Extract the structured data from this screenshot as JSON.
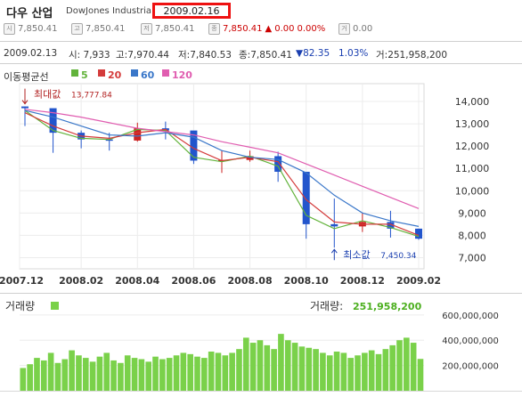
{
  "header": {
    "title": "다우 산업",
    "subtitle": "DowJones Industrial",
    "date": "2009.02.16"
  },
  "quote": {
    "open_icon": "시",
    "open": "7,850.41",
    "high_icon": "고",
    "high": "7,850.41",
    "low_icon": "저",
    "low": "7,850.41",
    "close_icon": "종",
    "close": "7,850.41",
    "change_arrow": "▲",
    "change": "0.00",
    "change_pct": "0.00%",
    "volume_icon": "거",
    "volume": "0.00"
  },
  "info": {
    "date": "2009.02.13",
    "open": "시: 7,933",
    "high": "고:7,970.44",
    "low": "저:7,840.53",
    "close": "종:7,850.41",
    "change": "▼82.35",
    "change_pct": "1.03%",
    "volume": "거:251,958,200"
  },
  "moving_avg": {
    "label": "이동평균선",
    "items": [
      {
        "period": "5",
        "color": "#62b33b"
      },
      {
        "period": "20",
        "color": "#d43b3b"
      },
      {
        "period": "60",
        "color": "#3a77c9"
      },
      {
        "period": "120",
        "color": "#e05db0"
      }
    ]
  },
  "volume_panel": {
    "title": "거래량",
    "value_label": "거래량:",
    "value": "251,958,200"
  },
  "colors": {
    "up": "#cc2222",
    "down": "#2255cc",
    "volume": "#7ad14a",
    "annotation_high": "#b22222",
    "annotation_low": "#1a3fb0"
  },
  "chart_data": [
    {
      "type": "candlestick",
      "title": "",
      "x": [
        "2007.12",
        "2008.01",
        "2008.02",
        "2008.03",
        "2008.04",
        "2008.05",
        "2008.06",
        "2008.07",
        "2008.08",
        "2008.09",
        "2008.10",
        "2008.11",
        "2008.12",
        "2009.01",
        "2009.02"
      ],
      "x_tick_labels": [
        "2007.12",
        "2008.02",
        "2008.04",
        "2008.06",
        "2008.08",
        "2008.10",
        "2008.12",
        "2009.02"
      ],
      "close": [
        13700,
        12600,
        12300,
        12250,
        12800,
        12700,
        11350,
        11380,
        11550,
        10850,
        8500,
        8400,
        8600,
        8300,
        7850
      ],
      "high": [
        13778,
        13100,
        12700,
        12600,
        13050,
        13100,
        12500,
        11800,
        11800,
        11750,
        10850,
        9650,
        9000,
        9100,
        8300
      ],
      "low": [
        12900,
        11700,
        11900,
        11800,
        12200,
        12300,
        11200,
        10800,
        11300,
        10400,
        7850,
        7450,
        8150,
        7900,
        7800
      ],
      "ylim": [
        6500,
        14800
      ],
      "y_ticks": [
        7000,
        8000,
        9000,
        10000,
        11000,
        12000,
        13000,
        14000
      ],
      "y_tick_labels": [
        "7,000",
        "8,000",
        "9,000",
        "10,000",
        "11,000",
        "12,000",
        "13,000",
        "14,000"
      ],
      "moving_averages": [
        {
          "name": "5",
          "values": [
            13600,
            12700,
            12350,
            12300,
            12750,
            12700,
            11500,
            11300,
            11550,
            11100,
            8900,
            8300,
            8650,
            8350,
            7950
          ]
        },
        {
          "name": "20",
          "values": [
            13500,
            12900,
            12450,
            12350,
            12600,
            12750,
            11900,
            11350,
            11500,
            11300,
            9600,
            8600,
            8500,
            8500,
            8000
          ]
        },
        {
          "name": "60",
          "values": [
            13600,
            13300,
            12900,
            12500,
            12450,
            12600,
            12400,
            11800,
            11500,
            11400,
            10800,
            9800,
            9000,
            8650,
            8400
          ]
        },
        {
          "name": "120",
          "values": [
            13650,
            13500,
            13300,
            13050,
            12800,
            12650,
            12500,
            12200,
            11950,
            11700,
            11200,
            10700,
            10200,
            9700,
            9200
          ]
        }
      ],
      "annotations": [
        {
          "label": "최대값",
          "value": "13,777.84",
          "x": "2007.12"
        },
        {
          "label": "최소값",
          "value": "7,450.34",
          "x": "2008.11"
        }
      ],
      "grid": true
    },
    {
      "type": "bar",
      "title": "",
      "series_name": "거래량",
      "x_range": [
        "2007.12",
        "2009.02"
      ],
      "bar_count": 58,
      "values": [
        180000000,
        210000000,
        260000000,
        240000000,
        300000000,
        220000000,
        250000000,
        320000000,
        280000000,
        260000000,
        230000000,
        270000000,
        300000000,
        240000000,
        220000000,
        280000000,
        260000000,
        250000000,
        230000000,
        270000000,
        250000000,
        260000000,
        280000000,
        300000000,
        290000000,
        270000000,
        260000000,
        310000000,
        300000000,
        280000000,
        300000000,
        330000000,
        420000000,
        380000000,
        400000000,
        360000000,
        330000000,
        450000000,
        400000000,
        380000000,
        350000000,
        340000000,
        330000000,
        300000000,
        280000000,
        310000000,
        300000000,
        260000000,
        280000000,
        300000000,
        320000000,
        290000000,
        330000000,
        360000000,
        400000000,
        420000000,
        380000000,
        251958200
      ],
      "ylim": [
        0,
        620000000
      ],
      "y_ticks": [
        200000000,
        400000000,
        600000000
      ],
      "y_tick_labels": [
        "200,000,000",
        "400,000,000",
        "600,000,000"
      ]
    }
  ]
}
